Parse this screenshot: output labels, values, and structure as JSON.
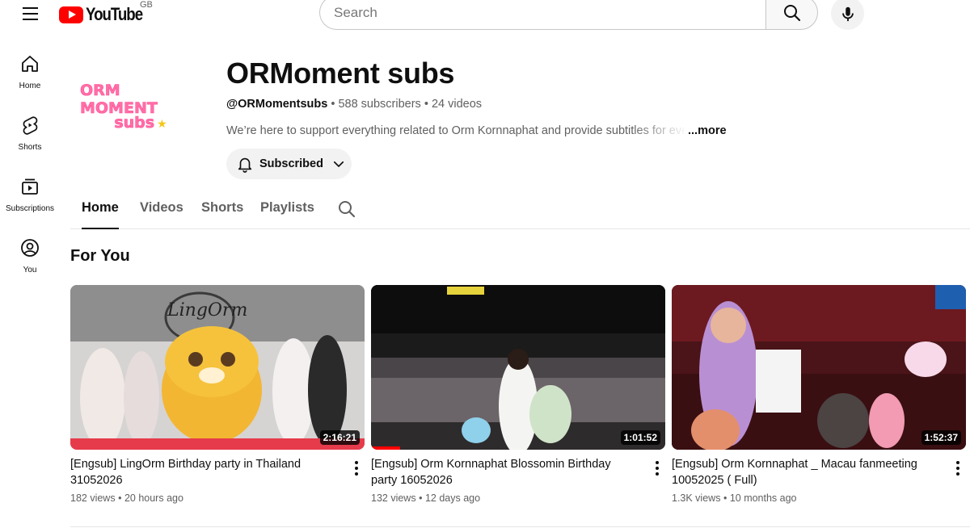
{
  "header": {
    "logo_text": "YouTube",
    "region": "GB",
    "search_placeholder": "Search"
  },
  "sidebar": {
    "items": [
      {
        "label": "Home",
        "icon": "home-icon"
      },
      {
        "label": "Shorts",
        "icon": "shorts-icon"
      },
      {
        "label": "Subscriptions",
        "icon": "subscriptions-icon"
      },
      {
        "label": "You",
        "icon": "account-circle-icon"
      }
    ]
  },
  "channel": {
    "avatar_line1": "ORM MOMENT",
    "avatar_line2": "subs",
    "title": "ORMoment subs",
    "handle": "@ORMomentsubs",
    "subscribers": "588 subscribers",
    "videos": "24 videos",
    "separator": "•",
    "description": "We’re here to support everything related to Orm Kornnaphat and provide subtitles for every video",
    "more": "...more",
    "subscribe_label": "Subscribed"
  },
  "tabs": [
    {
      "label": "Home",
      "active": true
    },
    {
      "label": "Videos",
      "active": false
    },
    {
      "label": "Shorts",
      "active": false
    },
    {
      "label": "Playlists",
      "active": false
    }
  ],
  "section": {
    "title": "For You"
  },
  "videos": [
    {
      "title": "[Engsub] LingOrm Birthday party in Thailand 31052026",
      "views": "182 views",
      "age": "20 hours ago",
      "duration": "2:16:21",
      "watched_fraction": 0
    },
    {
      "title": "[Engsub] Orm Kornnaphat Blossomin Birthday party 16052026",
      "views": "132 views",
      "age": "12 days ago",
      "duration": "1:01:52",
      "watched_fraction": 0.1
    },
    {
      "title": "[Engsub] Orm Kornnaphat _ Macau fanmeeting 10052025  ( Full)",
      "views": "1.3K views",
      "age": "10 months ago",
      "duration": "1:52:37",
      "watched_fraction": 0
    }
  ],
  "colors": {
    "brand_red": "#ff0000",
    "avatar_pink": "#ff6fa8",
    "text_secondary": "#606060"
  }
}
